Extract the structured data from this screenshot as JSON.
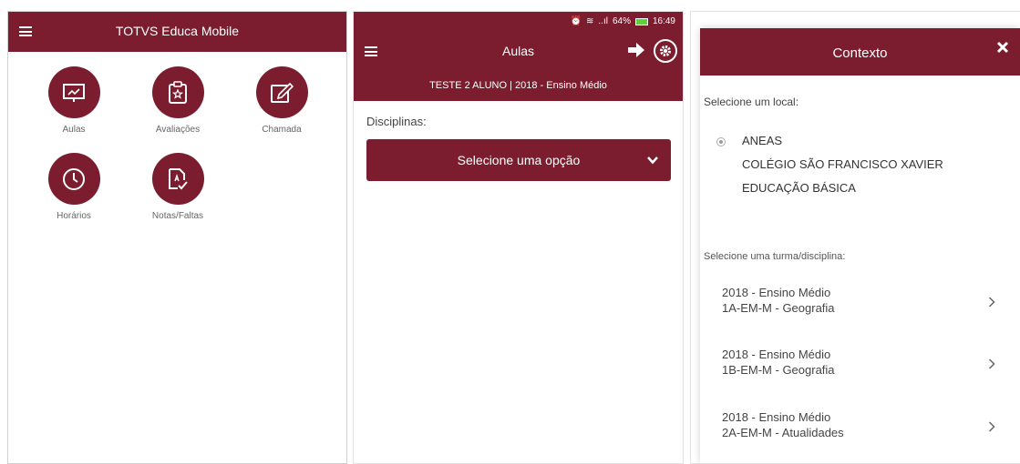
{
  "screen1": {
    "title": "TOTVS Educa Mobile",
    "tiles": [
      {
        "label": "Aulas",
        "icon": "presentation-board-icon"
      },
      {
        "label": "Avaliações",
        "icon": "clipboard-star-icon"
      },
      {
        "label": "Chamada",
        "icon": "edit-note-icon"
      },
      {
        "label": "Horários",
        "icon": "clock-icon"
      },
      {
        "label": "Notas/Faltas",
        "icon": "grade-document-icon"
      }
    ]
  },
  "screen2": {
    "status": {
      "signal": "..ıl",
      "battery": "64%",
      "time": "16:49"
    },
    "title": "Aulas",
    "subtitle": "TESTE 2 ALUNO | 2018 - Ensino Médio",
    "disciplinas_label": "Disciplinas:",
    "select_placeholder": "Selecione uma opção"
  },
  "screen3": {
    "title": "Contexto",
    "local_label": "Selecione um local:",
    "local": {
      "line1": "ANEAS",
      "line2": "COLÉGIO SÃO FRANCISCO XAVIER",
      "line3": "EDUCAÇÃO BÁSICA"
    },
    "turma_label": "Selecione uma turma/disciplina:",
    "items": [
      {
        "line1": "2018 - Ensino Médio",
        "line2": "1A-EM-M - Geografia"
      },
      {
        "line1": "2018 - Ensino Médio",
        "line2": "1B-EM-M - Geografia"
      },
      {
        "line1": "2018 - Ensino Médio",
        "line2": "2A-EM-M - Atualidades"
      }
    ]
  },
  "colors": {
    "brand": "#7b1d2e",
    "background": "#ffffff"
  }
}
